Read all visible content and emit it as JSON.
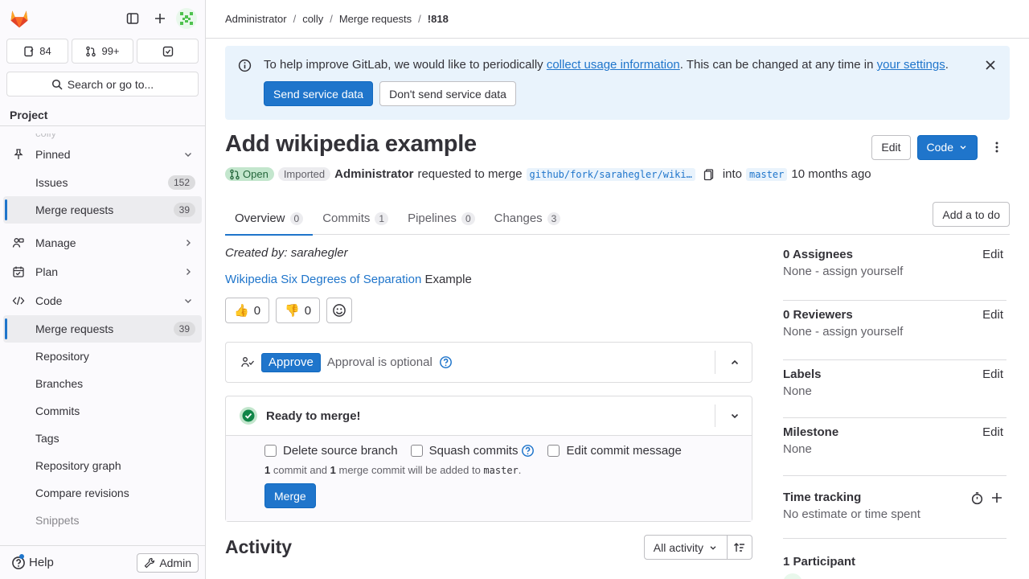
{
  "sidebar": {
    "counts": {
      "issues": "84",
      "merge_requests": "99+"
    },
    "search_label": "Search or go to...",
    "context_label": "Project",
    "ghost_label": "colly",
    "nav": {
      "pinned": "Pinned",
      "pinned_issues": "Issues",
      "pinned_issues_count": "152",
      "pinned_mr": "Merge requests",
      "pinned_mr_count": "39",
      "manage": "Manage",
      "plan": "Plan",
      "code": "Code",
      "code_mr": "Merge requests",
      "code_mr_count": "39",
      "repository": "Repository",
      "branches": "Branches",
      "commits": "Commits",
      "tags": "Tags",
      "repo_graph": "Repository graph",
      "compare": "Compare revisions",
      "snippets": "Snippets"
    },
    "help_label": "Help",
    "admin_label": "Admin"
  },
  "breadcrumb": [
    "Administrator",
    "colly",
    "Merge requests",
    "!818"
  ],
  "banner": {
    "text_before": "To help improve GitLab, we would like to periodically ",
    "link1": "collect usage information",
    "text_middle": ". This can be changed at any time in ",
    "link2": "your settings",
    "text_after": ".",
    "send_label": "Send service data",
    "dont_send_label": "Don't send service data"
  },
  "mr": {
    "title": "Add wikipedia example",
    "edit_label": "Edit",
    "code_label": "Code",
    "status": "Open",
    "imported": "Imported",
    "author": "Administrator",
    "requested": "requested to merge",
    "source_branch": "github/fork/sarahegler/wiki…",
    "into": "into",
    "target_branch": "master",
    "time": "10 months ago"
  },
  "tabs": [
    {
      "label": "Overview",
      "count": "0"
    },
    {
      "label": "Commits",
      "count": "1"
    },
    {
      "label": "Pipelines",
      "count": "0"
    },
    {
      "label": "Changes",
      "count": "3"
    }
  ],
  "todo_label": "Add a to do",
  "description": {
    "created_by": "Created by: sarahegler",
    "link": "Wikipedia Six Degrees of Separation",
    "suffix": " Example"
  },
  "reactions": {
    "thumbs_up": "0",
    "thumbs_down": "0"
  },
  "approval": {
    "approve_label": "Approve",
    "text": "Approval is optional"
  },
  "merge": {
    "status": "Ready to merge!",
    "delete_source": "Delete source branch",
    "squash": "Squash commits",
    "edit_message": "Edit commit message",
    "note_count1": "1",
    "note_text1": " commit and ",
    "note_count2": "1",
    "note_text2": " merge commit will be added to ",
    "note_branch": "master",
    "note_end": ".",
    "merge_label": "Merge"
  },
  "activity": {
    "title": "Activity",
    "filter": "All activity"
  },
  "side": {
    "assignees": {
      "label": "0 Assignees",
      "value": "None - assign yourself"
    },
    "reviewers": {
      "label": "0 Reviewers",
      "value": "None - assign yourself"
    },
    "labels": {
      "label": "Labels",
      "value": "None"
    },
    "milestone": {
      "label": "Milestone",
      "value": "None"
    },
    "time_tracking": {
      "label": "Time tracking",
      "value": "No estimate or time spent"
    },
    "participants": {
      "label": "1 Participant"
    },
    "edit_label": "Edit"
  },
  "colors": {
    "accent": "#1f75cb",
    "open_badge": "#c3e6cd",
    "banner": "#e9f3fc",
    "success": "#108548"
  }
}
